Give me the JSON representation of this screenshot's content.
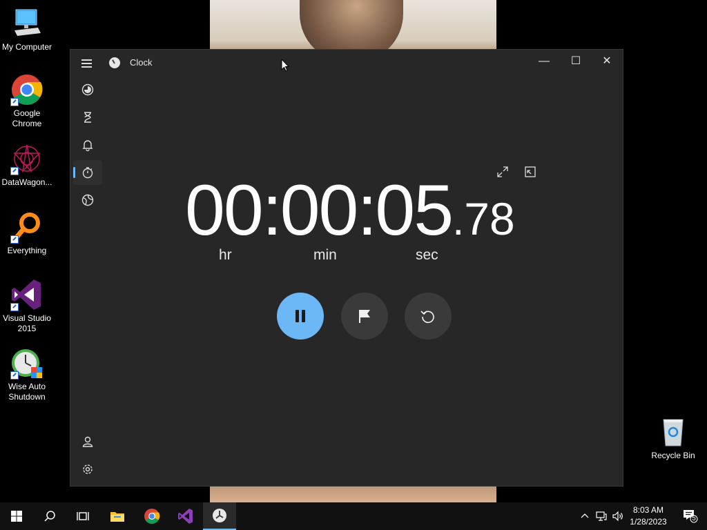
{
  "desktop": {
    "icons": [
      {
        "label": "My Computer"
      },
      {
        "label": "Google Chrome"
      },
      {
        "label": "DataWagon..."
      },
      {
        "label": "Everything"
      },
      {
        "label": "Visual Studio 2015"
      },
      {
        "label": "Wise Auto Shutdown"
      },
      {
        "label": "Recycle Bin"
      }
    ]
  },
  "window": {
    "title": "Clock",
    "controls": {
      "minimize": "—",
      "maximize": "☐",
      "close": "✕"
    }
  },
  "nav": {
    "items": [
      {
        "name": "focus-sessions"
      },
      {
        "name": "timer"
      },
      {
        "name": "alarm"
      },
      {
        "name": "stopwatch",
        "active": true
      },
      {
        "name": "world-clock"
      }
    ]
  },
  "stopwatch": {
    "hours": "00",
    "minutes": "00",
    "seconds": "05",
    "separator": ":",
    "decimal": ".",
    "hundredths": "78",
    "unit_hr": "hr",
    "unit_min": "min",
    "unit_sec": "sec"
  },
  "taskbar": {
    "time": "8:03 AM",
    "date": "1/28/2023",
    "notification_count": "5"
  },
  "colors": {
    "accent": "#6cb8f6",
    "window_bg": "#272727",
    "button_bg": "#3a3a3a"
  }
}
